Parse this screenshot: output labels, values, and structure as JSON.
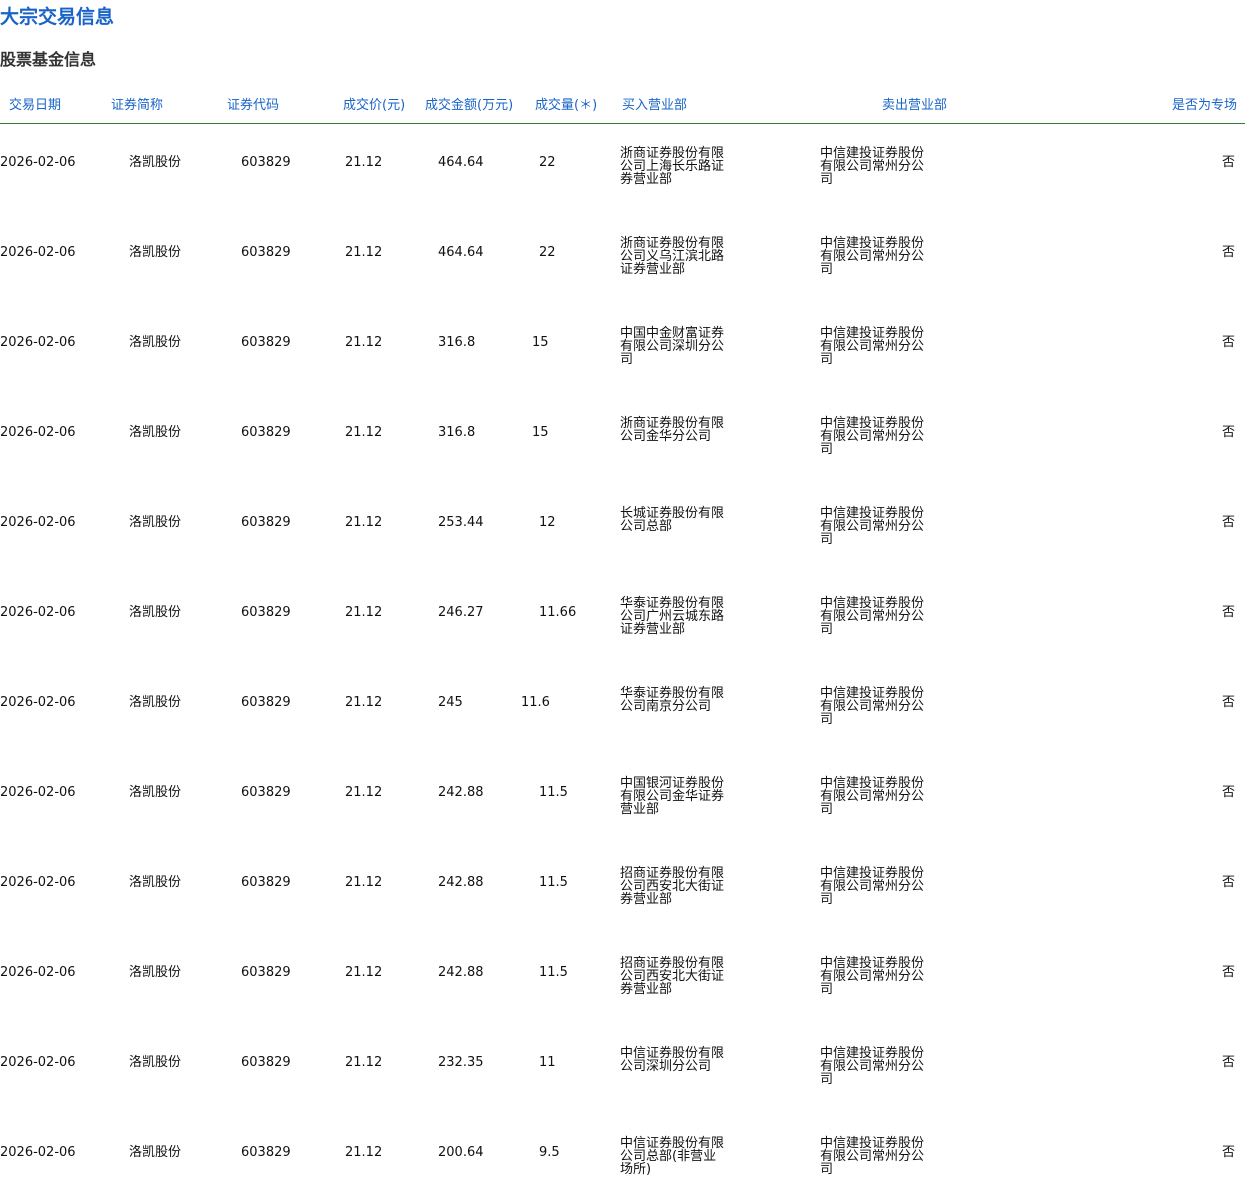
{
  "page": {
    "title": "大宗交易信息",
    "section_title": "股票基金信息"
  },
  "table": {
    "headers": {
      "date": "交易日期",
      "name": "证券简称",
      "code": "证券代码",
      "price": "成交价(元)",
      "amount": "成交金额(万元)",
      "volume": "成交量(＊)",
      "buy": "买入营业部",
      "sell": "卖出营业部",
      "flag": "是否为专场"
    },
    "rows": [
      {
        "date": "2026-02-06",
        "name": "洛凯股份",
        "code": "603829",
        "price": "21.12",
        "amount": "464.64",
        "volume": "22",
        "buy": "浙商证券股份有限公司上海长乐路证券营业部",
        "sell": "中信建投证券股份有限公司常州分公司",
        "flag": "否"
      },
      {
        "date": "2026-02-06",
        "name": "洛凯股份",
        "code": "603829",
        "price": "21.12",
        "amount": "464.64",
        "volume": "22",
        "buy": "浙商证券股份有限公司义乌江滨北路证券营业部",
        "sell": "中信建投证券股份有限公司常州分公司",
        "flag": "否"
      },
      {
        "date": "2026-02-06",
        "name": "洛凯股份",
        "code": "603829",
        "price": "21.12",
        "amount": "316.8",
        "volume": "15",
        "buy": "中国中金财富证券有限公司深圳分公司",
        "sell": "中信建投证券股份有限公司常州分公司",
        "flag": "否"
      },
      {
        "date": "2026-02-06",
        "name": "洛凯股份",
        "code": "603829",
        "price": "21.12",
        "amount": "316.8",
        "volume": "15",
        "buy": "浙商证券股份有限公司金华分公司",
        "sell": "中信建投证券股份有限公司常州分公司",
        "flag": "否"
      },
      {
        "date": "2026-02-06",
        "name": "洛凯股份",
        "code": "603829",
        "price": "21.12",
        "amount": "253.44",
        "volume": "12",
        "buy": "长城证券股份有限公司总部",
        "sell": "中信建投证券股份有限公司常州分公司",
        "flag": "否"
      },
      {
        "date": "2026-02-06",
        "name": "洛凯股份",
        "code": "603829",
        "price": "21.12",
        "amount": "246.27",
        "volume": "11.66",
        "buy": "华泰证券股份有限公司广州云城东路证券营业部",
        "sell": "中信建投证券股份有限公司常州分公司",
        "flag": "否"
      },
      {
        "date": "2026-02-06",
        "name": "洛凯股份",
        "code": "603829",
        "price": "21.12",
        "amount": "245",
        "volume": "11.6",
        "buy": "华泰证券股份有限公司南京分公司",
        "sell": "中信建投证券股份有限公司常州分公司",
        "flag": "否"
      },
      {
        "date": "2026-02-06",
        "name": "洛凯股份",
        "code": "603829",
        "price": "21.12",
        "amount": "242.88",
        "volume": "11.5",
        "buy": "中国银河证券股份有限公司金华证券营业部",
        "sell": "中信建投证券股份有限公司常州分公司",
        "flag": "否"
      },
      {
        "date": "2026-02-06",
        "name": "洛凯股份",
        "code": "603829",
        "price": "21.12",
        "amount": "242.88",
        "volume": "11.5",
        "buy": "招商证券股份有限公司西安北大街证券营业部",
        "sell": "中信建投证券股份有限公司常州分公司",
        "flag": "否"
      },
      {
        "date": "2026-02-06",
        "name": "洛凯股份",
        "code": "603829",
        "price": "21.12",
        "amount": "242.88",
        "volume": "11.5",
        "buy": "招商证券股份有限公司西安北大街证券营业部",
        "sell": "中信建投证券股份有限公司常州分公司",
        "flag": "否"
      },
      {
        "date": "2026-02-06",
        "name": "洛凯股份",
        "code": "603829",
        "price": "21.12",
        "amount": "232.35",
        "volume": "11",
        "buy": "中信证券股份有限公司深圳分公司",
        "sell": "中信建投证券股份有限公司常州分公司",
        "flag": "否"
      },
      {
        "date": "2026-02-06",
        "name": "洛凯股份",
        "code": "603829",
        "price": "21.12",
        "amount": "200.64",
        "volume": "9.5",
        "buy": "中信证券股份有限公司总部(非营业场所)",
        "sell": "中信建投证券股份有限公司常州分公司",
        "flag": "否"
      }
    ]
  }
}
